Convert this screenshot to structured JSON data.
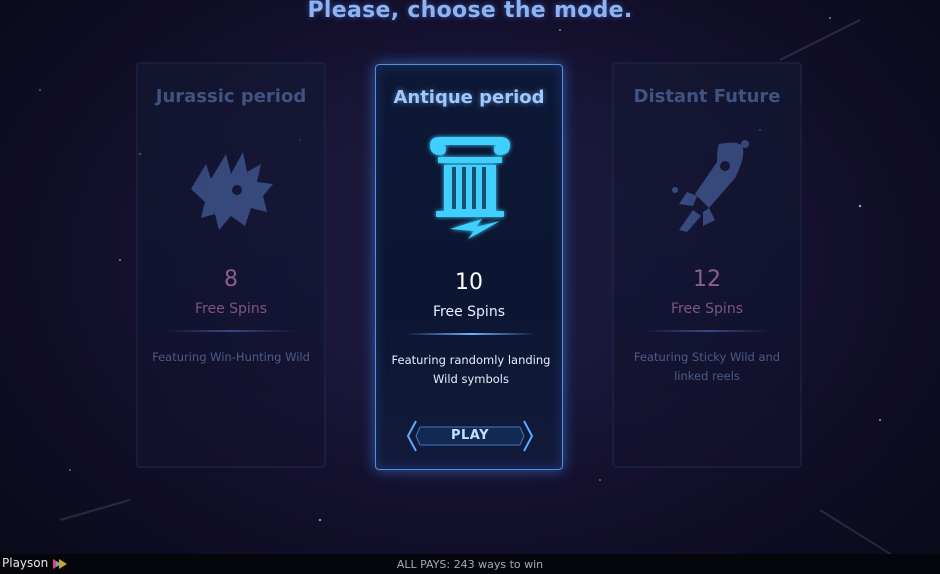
{
  "header": {
    "title": "Please, choose the mode."
  },
  "modes": [
    {
      "title": "Jurassic period",
      "count": "8",
      "spins_label": "Free Spins",
      "description": "Featuring Win-Hunting Wild",
      "icon": "triceratops-icon",
      "selected": false
    },
    {
      "title": "Antique period",
      "count": "10",
      "spins_label": "Free Spins",
      "description": "Featuring randomly landing Wild symbols",
      "icon": "greek-column-icon",
      "selected": true,
      "button_label": "PLAY"
    },
    {
      "title": "Distant Future",
      "count": "12",
      "spins_label": "Free Spins",
      "description": "Featuring Sticky Wild and linked reels",
      "icon": "rocket-icon",
      "selected": false
    }
  ],
  "footer": {
    "brand": "Playson",
    "pays": "ALL PAYS: 243 ways to win"
  },
  "colors": {
    "accent": "#4f8fdc",
    "title": "#8fb3f0",
    "free_spins_dim": "#c07ab0",
    "icon_active": "#3fd0ff"
  }
}
